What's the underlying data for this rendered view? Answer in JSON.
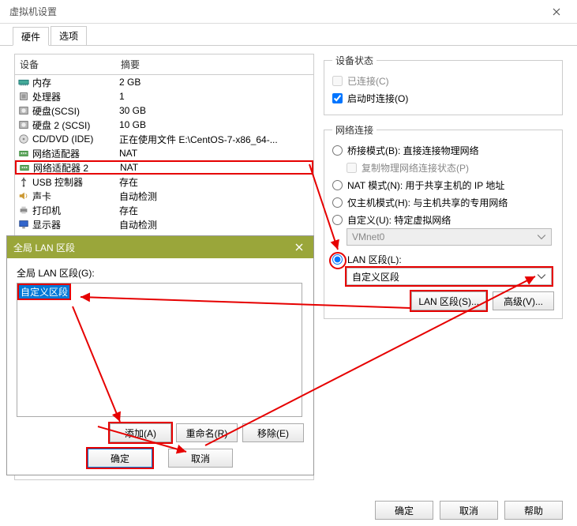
{
  "window": {
    "title": "虚拟机设置"
  },
  "tabs": {
    "hardware": "硬件",
    "options": "选项"
  },
  "device_table": {
    "col_device": "设备",
    "col_summary": "摘要",
    "rows": [
      {
        "icon": "memory",
        "name": "内存",
        "summary": "2 GB"
      },
      {
        "icon": "cpu",
        "name": "处理器",
        "summary": "1"
      },
      {
        "icon": "disk",
        "name": "硬盘(SCSI)",
        "summary": "30 GB"
      },
      {
        "icon": "disk",
        "name": "硬盘 2 (SCSI)",
        "summary": "10 GB"
      },
      {
        "icon": "cd",
        "name": "CD/DVD (IDE)",
        "summary": "正在使用文件 E:\\CentOS-7-x86_64-..."
      },
      {
        "icon": "nic",
        "name": "网络适配器",
        "summary": "NAT"
      },
      {
        "icon": "nic",
        "name": "网络适配器 2",
        "summary": "NAT",
        "selected": true
      },
      {
        "icon": "usb",
        "name": "USB 控制器",
        "summary": "存在"
      },
      {
        "icon": "sound",
        "name": "声卡",
        "summary": "自动检测"
      },
      {
        "icon": "print",
        "name": "打印机",
        "summary": "存在"
      },
      {
        "icon": "display",
        "name": "显示器",
        "summary": "自动检测"
      }
    ]
  },
  "status": {
    "legend": "设备状态",
    "connected": "已连接(C)",
    "connect_on": "启动时连接(O)"
  },
  "netconn": {
    "legend": "网络连接",
    "bridged": "桥接模式(B): 直接连接物理网络",
    "replicate": "复制物理网络连接状态(P)",
    "nat": "NAT 模式(N): 用于共享主机的 IP 地址",
    "hostonly": "仅主机模式(H): 与主机共享的专用网络",
    "custom": "自定义(U): 特定虚拟网络",
    "custom_value": "VMnet0",
    "lanseg": "LAN 区段(L):",
    "lanseg_value": "自定义区段",
    "btn_lanseg": "LAN 区段(S)...",
    "btn_adv": "高级(V)..."
  },
  "lan_dialog": {
    "title": "全局 LAN 区段",
    "label": "全局 LAN 区段(G):",
    "selected": "自定义区段",
    "add": "添加(A)",
    "rename": "重命名(R)",
    "remove": "移除(E)",
    "ok": "确定",
    "cancel": "取消"
  },
  "footer": {
    "ok": "确定",
    "cancel": "取消",
    "help": "帮助"
  }
}
